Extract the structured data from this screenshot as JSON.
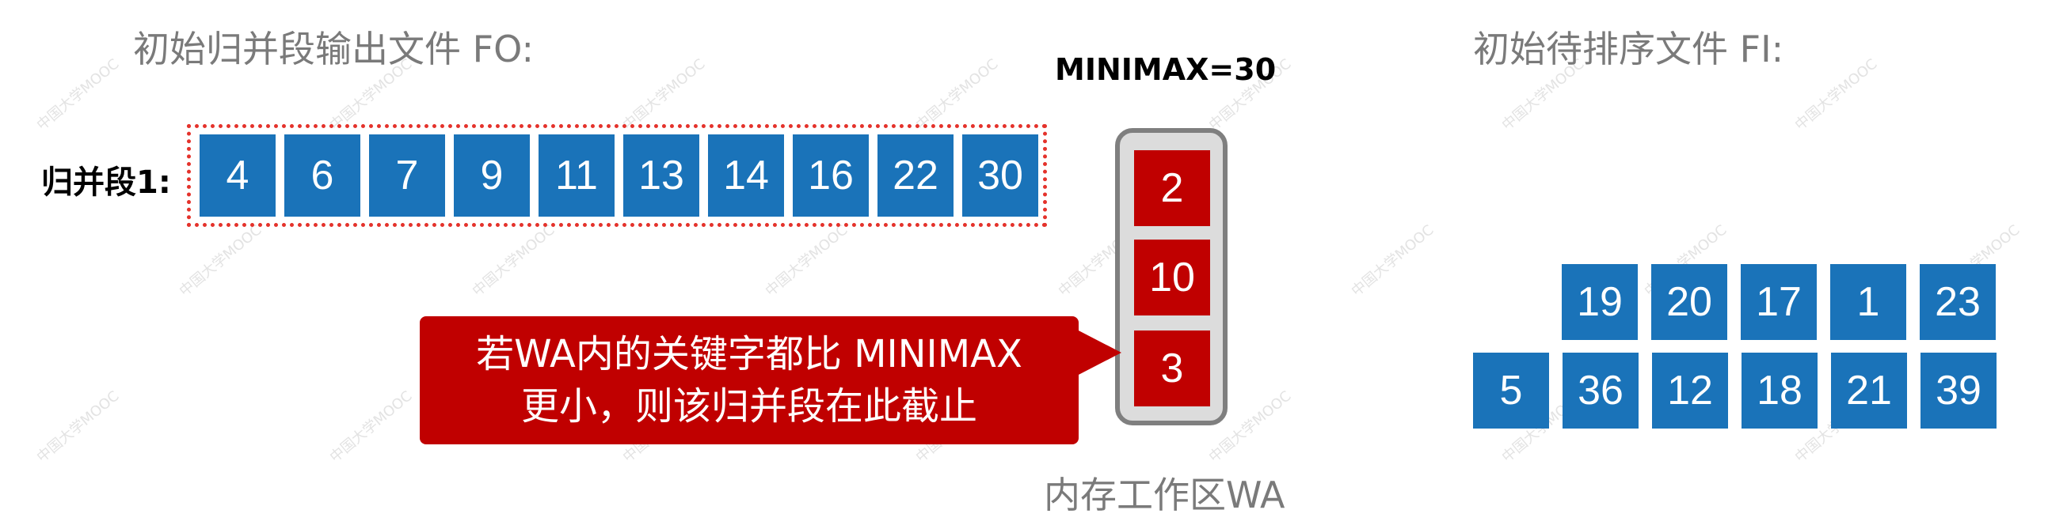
{
  "left": {
    "title": "初始归并段输出文件 FO:",
    "row_label": "归并段1:",
    "segment_values": [
      "4",
      "6",
      "7",
      "9",
      "11",
      "13",
      "14",
      "16",
      "22",
      "30"
    ]
  },
  "middle": {
    "minimax_label": "MINIMAX=30",
    "wa_values": [
      "2",
      "10",
      "3"
    ],
    "wa_caption": "内存工作区WA"
  },
  "callout": {
    "line1": "若WA内的关键字都比 MINIMAX",
    "line2": "更小，则该归并段在此截止"
  },
  "right": {
    "title": "初始待排序文件 FI:",
    "row1": [
      "19",
      "20",
      "17",
      "1",
      "23"
    ],
    "row2": [
      "5",
      "36",
      "12",
      "18",
      "21",
      "39"
    ]
  },
  "watermark": {
    "text": "中国大学MOOC"
  },
  "colors": {
    "blue": "#1a73b9",
    "red": "#c00000",
    "frame_gray": "#7f7f7f",
    "dotted_red": "#e4322b"
  }
}
